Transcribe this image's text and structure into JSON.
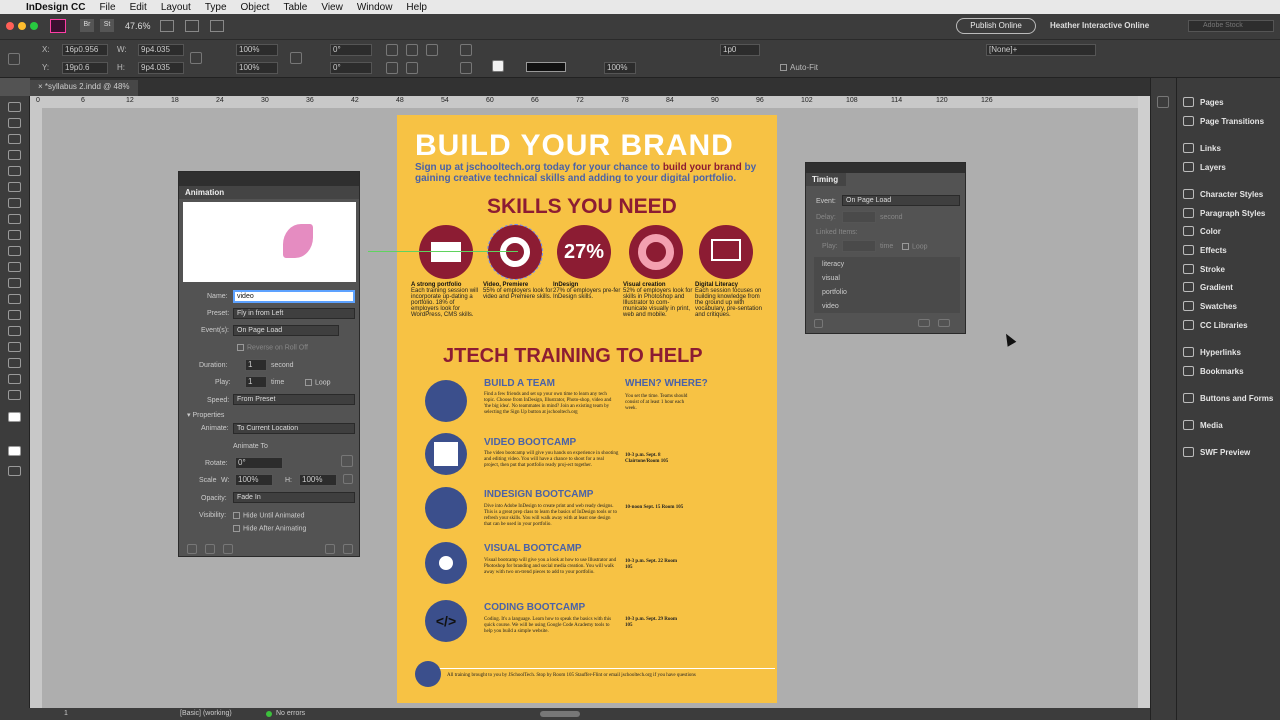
{
  "menubar": {
    "app": "InDesign CC",
    "items": [
      "File",
      "Edit",
      "Layout",
      "Type",
      "Object",
      "Table",
      "View",
      "Window",
      "Help"
    ]
  },
  "appbar": {
    "zoom": "47.6%",
    "publish": "Publish Online",
    "workspace": "Heather Interactive Online",
    "search_placeholder": "Adobe Stock",
    "br": "Br",
    "st": "St"
  },
  "control": {
    "x": "16p0.956",
    "y": "19p0.6",
    "w": "9p4.035",
    "h": "9p4.035",
    "scale_x": "100%",
    "scale_y": "100%",
    "rot": "0°",
    "shear": "0°",
    "stroke": "1p0",
    "pct": "100%",
    "autofit": "Auto-Fit",
    "style": "[None]+"
  },
  "doctab": {
    "label": "*syllabus 2.indd @ 48%"
  },
  "ruler": {
    "ticks": [
      "0",
      "6",
      "12",
      "18",
      "24",
      "30",
      "36",
      "42",
      "48",
      "54",
      "60",
      "66",
      "72",
      "78",
      "84",
      "90",
      "96",
      "102",
      "108",
      "114",
      "120",
      "126"
    ]
  },
  "status": {
    "page": "1",
    "style": "[Basic] (working)",
    "errors": "No errors"
  },
  "animation": {
    "title": "Animation",
    "name_label": "Name:",
    "name": "video",
    "preset_label": "Preset:",
    "preset": "Fly in from Left",
    "event_label": "Event(s):",
    "event": "On Page Load",
    "reverse": "Reverse on Roll Off",
    "duration_label": "Duration:",
    "duration": "1",
    "duration_unit": "second",
    "play_label": "Play:",
    "play": "1",
    "play_unit": "time",
    "loop": "Loop",
    "speed_label": "Speed:",
    "speed": "From Preset",
    "properties": "Properties",
    "animate_label": "Animate:",
    "animate": "To Current Location",
    "animate_to": "Animate To",
    "rotate_label": "Rotate:",
    "rotate": "0°",
    "scale_label": "Scale",
    "w_label": "W:",
    "w": "100%",
    "h_label": "H:",
    "h": "100%",
    "opacity_label": "Opacity:",
    "opacity": "Fade In",
    "visibility_label": "Visibility:",
    "hide_until": "Hide Until Animated",
    "hide_after": "Hide After Animating"
  },
  "timing": {
    "title": "Timing",
    "event_label": "Event:",
    "event": "On Page Load",
    "delay_label": "Delay:",
    "delay_unit": "second",
    "linked": "Linked Items:",
    "play_label": "Play:",
    "play_unit": "time",
    "loop": "Loop",
    "items": [
      "literacy",
      "visual",
      "portfolio",
      "video"
    ]
  },
  "dock": {
    "items": [
      "Pages",
      "Page Transitions",
      "Links",
      "Layers",
      "Character Styles",
      "Paragraph Styles",
      "Color",
      "Effects",
      "Stroke",
      "Gradient",
      "Swatches",
      "CC Libraries",
      "Hyperlinks",
      "Bookmarks",
      "Buttons and Forms",
      "Media",
      "SWF Preview"
    ]
  },
  "poster": {
    "title": "BUILD YOUR BRAND",
    "sub_a": "Sign up at jschooltech.org today for your chance to ",
    "sub_b": "build your brand",
    "sub_c": " by gaining creative technical skills and adding to your digital portfolio.",
    "skills_heading": "SKILLS YOU NEED",
    "pct": "27%",
    "skills": [
      {
        "title": "A strong portfolio",
        "text": "Each training session will incorporate up-dating a portfolio. 18% of employers look for WordPress, CMS skills."
      },
      {
        "title": "Video, Premiere",
        "text": "55% of employers look for video and Premiere skills."
      },
      {
        "title": "InDesign",
        "text": "27% of employers pre-fer InDesign skills."
      },
      {
        "title": "Visual creation",
        "text": "52% of employers look for skills in Photoshop and Illustrator to com-municate visually in print, web and mobile."
      },
      {
        "title": "Digital Literacy",
        "text": "Each session focuses on building knowledge from the ground up with vocabulary, pre-sentation and critiques."
      }
    ],
    "training_heading": "JTECH TRAINING TO HELP",
    "when_heading": "WHEN? WHERE?",
    "courses": [
      {
        "title": "BUILD A TEAM",
        "text": "Find a few friends and set up your own time to learn any tech topic. Choose from InDesign, Illustrator, Photo-shop, video and 'the big idea'. No teammates in mind? Join an existing team by selecting the Sign Up button at jschooltech.org",
        "when": "You set the time. Teams should consist of at least 1 hour each week."
      },
      {
        "title": "VIDEO BOOTCAMP",
        "text": "The video bootcamp will give you hands on experience in shooting and editing video. You will have a chance to shoot for a real project, then put that portfolio ready proj-ect together.",
        "when": "10-3 p.m. Sept. 8 Clairtone/Room 105"
      },
      {
        "title": "INDESIGN BOOTCAMP",
        "text": "Dive into Adobe InDesign to create print and web ready designs. This is a great prep class to learn the basics of InDesign tools or to refresh your skills. You will walk away with at least one design that can be used in your portfolio.",
        "when": "10-noon Sept. 15 Room 105"
      },
      {
        "title": "VISUAL BOOTCAMP",
        "text": "Visual bootcamp will give you a look at how to use Illustrator and Photoshop for branding and social media creation. You will walk away with two on-trend pieces to add to your portfolio.",
        "when": "10-3 p.m. Sept. 22 Room 105"
      },
      {
        "title": "CODING BOOTCAMP",
        "text": "Coding. It's a language. Learn how to speak the basics with this quick course. We will be using Google Code Academy tools to help you build a simple website.",
        "when": "10-3 p.m. Sept. 29 Room 105"
      }
    ],
    "footer": "All training brought to you by JSchoolTech. Stop by Room 105 Stauffer-Flint or email jschooltech.org if you have questions"
  },
  "colors": {
    "poster_bg": "#f7c244",
    "maroon": "#8c1c33",
    "navy": "#3b4f8c",
    "blue_text": "#4a62a8"
  }
}
